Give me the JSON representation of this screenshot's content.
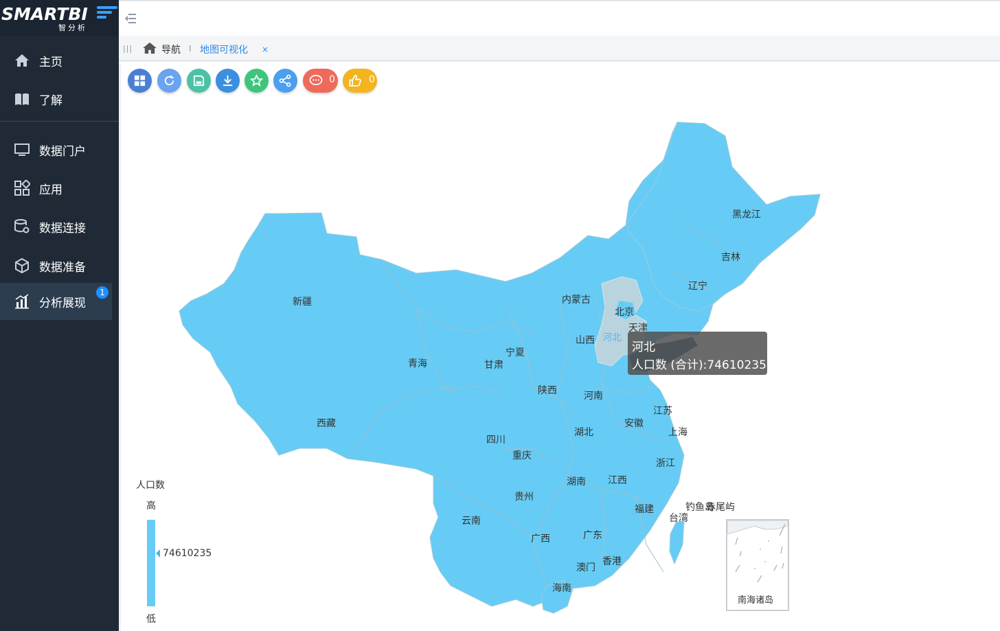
{
  "app": {
    "logo_text": "SMARTBI",
    "logo_subtitle": "智分析"
  },
  "sidebar": {
    "items": [
      {
        "label": "主页",
        "icon": "home-icon"
      },
      {
        "label": "了解",
        "icon": "book-icon"
      },
      {
        "label": "数据门户",
        "icon": "monitor-icon"
      },
      {
        "label": "应用",
        "icon": "apps-icon"
      },
      {
        "label": "数据连接",
        "icon": "database-settings-icon"
      },
      {
        "label": "数据准备",
        "icon": "cube-icon"
      },
      {
        "label": "分析展现",
        "icon": "bar-chart-icon",
        "badge": "1",
        "active": true
      }
    ]
  },
  "breadcrumb": {
    "home_label": "导航",
    "separator": "I",
    "tab_label": "地图可视化",
    "close_label": "×"
  },
  "toolbar": {
    "buttons": [
      {
        "name": "layout-button",
        "icon": "grid-icon",
        "color": "#4a7fd6"
      },
      {
        "name": "refresh-button",
        "icon": "refresh-icon",
        "color": "#6aa3f0"
      },
      {
        "name": "save-button",
        "icon": "save-icon",
        "color": "#4bc2a4"
      },
      {
        "name": "download-button",
        "icon": "download-icon",
        "color": "#3b8fde"
      },
      {
        "name": "favorite-button",
        "icon": "star-icon",
        "color": "#3fc57b"
      },
      {
        "name": "share-button",
        "icon": "share-icon",
        "color": "#4b9ff0"
      },
      {
        "name": "comment-button",
        "icon": "comment-icon",
        "color": "#ee6a5b",
        "count": "0"
      },
      {
        "name": "like-button",
        "icon": "thumb-up-icon",
        "color": "#f4b41f",
        "count": "0"
      }
    ]
  },
  "chart_data": {
    "type": "map",
    "region": "China provinces",
    "measure": "人口数",
    "fill_color": "#66ccf5",
    "highlight_color": "#b9d4de",
    "hover": {
      "province": "河北",
      "label": "人口数 (合计):74610235",
      "value": 74610235
    },
    "province_labels": [
      "黑龙江",
      "吉林",
      "辽宁",
      "内蒙古",
      "北京",
      "天津",
      "河北",
      "山西",
      "新疆",
      "青海",
      "宁夏",
      "甘肃",
      "陕西",
      "河南",
      "西藏",
      "四川",
      "湖北",
      "安徽",
      "江苏",
      "上海",
      "重庆",
      "浙江",
      "湖南",
      "江西",
      "贵州",
      "福建",
      "云南",
      "广西",
      "广东",
      "台湾",
      "钓鱼岛",
      "赤尾屿",
      "香港",
      "澳门",
      "海南",
      "南海诸岛"
    ],
    "legend": {
      "title": "人口数",
      "high_label": "高",
      "low_label": "低",
      "marker_value": "74610235"
    }
  }
}
